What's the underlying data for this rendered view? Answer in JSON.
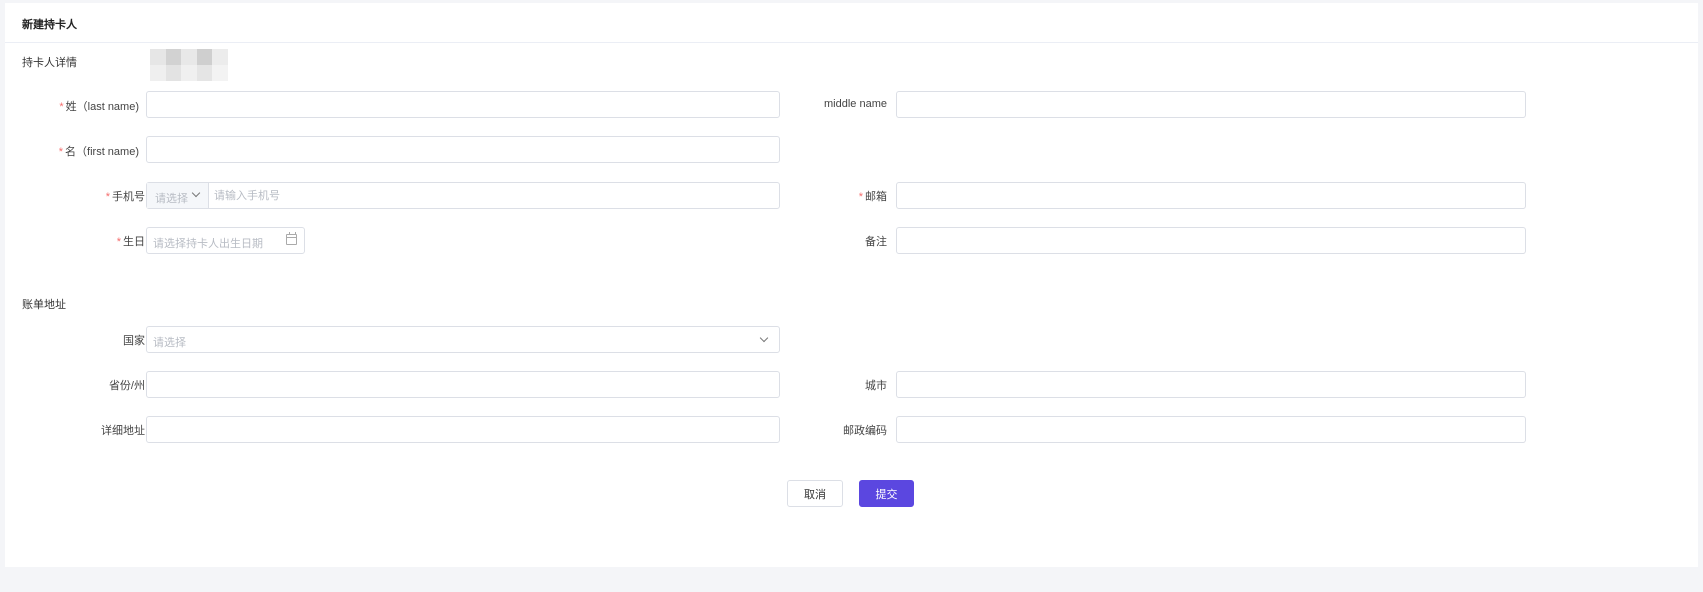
{
  "page": {
    "title": "新建持卡人"
  },
  "cardholder_section": {
    "title": "持卡人详情",
    "last_name": {
      "label": "姓（last name)",
      "value": "",
      "required": true
    },
    "middle_name": {
      "label": "middle name",
      "value": ""
    },
    "first_name": {
      "label": "名（first name)",
      "value": "",
      "required": true
    },
    "phone": {
      "label": "手机号",
      "prefix_placeholder": "请选择",
      "placeholder": "请输入手机号",
      "required": true
    },
    "email": {
      "label": "邮箱",
      "value": "",
      "required": true
    },
    "birthday": {
      "label": "生日",
      "placeholder": "请选择持卡人出生日期",
      "required": true
    },
    "remark": {
      "label": "备注",
      "value": ""
    }
  },
  "billing_section": {
    "title": "账单地址",
    "country": {
      "label": "国家",
      "placeholder": "请选择"
    },
    "province": {
      "label": "省份/州",
      "value": ""
    },
    "city": {
      "label": "城市",
      "value": ""
    },
    "address": {
      "label": "详细地址",
      "value": ""
    },
    "postcode": {
      "label": "邮政编码",
      "value": ""
    }
  },
  "actions": {
    "cancel_label": "取消",
    "submit_label": "提交"
  },
  "colors": {
    "primary": "#5b47e0",
    "required": "#f56c6c",
    "border": "#dcdfe6",
    "background": "#f4f5f8"
  },
  "icons": {
    "chevron": "chevron-down-icon",
    "calendar": "calendar-icon"
  }
}
